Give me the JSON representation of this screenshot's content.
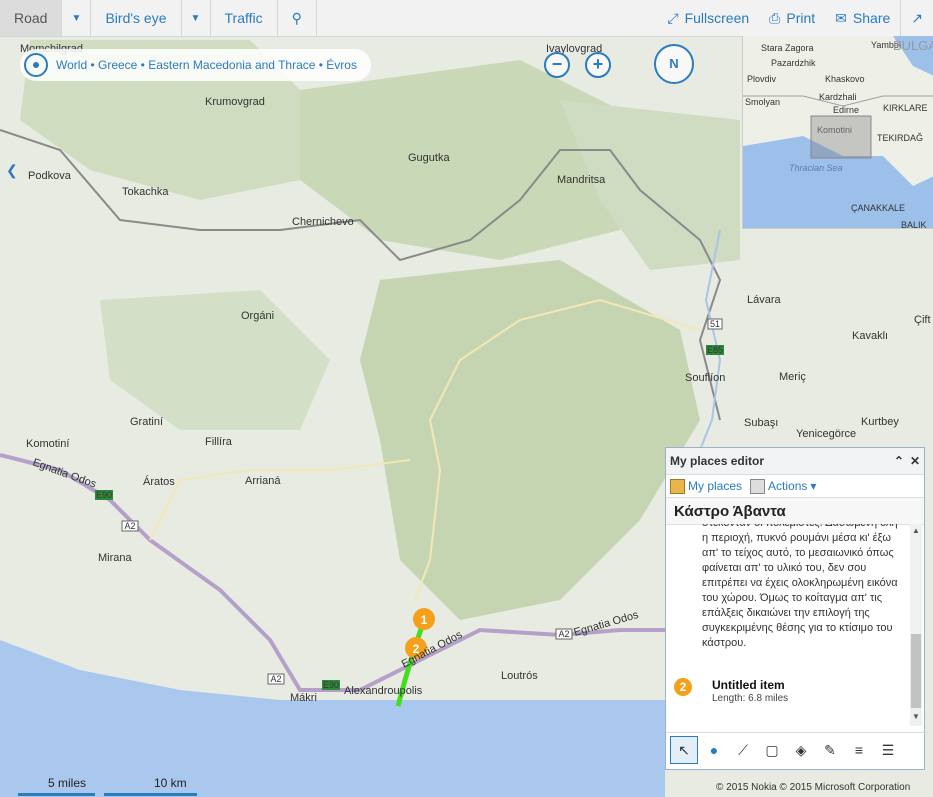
{
  "toolbar": {
    "road": "Road",
    "birds_eye": "Bird's eye",
    "traffic": "Traffic",
    "fullscreen": "Fullscreen",
    "print": "Print",
    "share": "Share"
  },
  "breadcrumb": "World • Greece • Eastern Macedonia and Thrace • Évros",
  "compass": "N",
  "places": {
    "momchilgrad": "Momchilgrad",
    "ivaylovgrad": "Ivaylovgrad",
    "krumovgrad": "Krumovgrad",
    "gugutka": "Gugutka",
    "podkova": "Podkova",
    "tokachka": "Tokachka",
    "mandritsa": "Mandritsa",
    "chernichevo": "Chernichevo",
    "lavara": "Lávara",
    "organi": "Orgáni",
    "kavakli": "Kavaklı",
    "souflion": "Souflíon",
    "meric": "Meriç",
    "gratini": "Gratiní",
    "subasi": "Subaşı",
    "kurtbey": "Kurtbey",
    "yenicegorce": "Yenicegörce",
    "komotini": "Komotiní",
    "fillira": "Fillíra",
    "egnatia_west": "Egnatia Odos",
    "aratos": "Áratos",
    "arriana": "Arrianá",
    "mirana": "Mirana",
    "loutros": "Loutrós",
    "alexandroupolis": "Alexandroupolis",
    "makri": "Mákri",
    "egnatia_east": "Egnatia Odos",
    "egnatia_south": "Egnatia Odos",
    "ciftl": "Çift"
  },
  "road_shields": [
    "E90",
    "A2",
    "A2",
    "A2",
    "E90",
    "51",
    "E85"
  ],
  "route_pins": [
    "1",
    "2"
  ],
  "minimap": {
    "stara_zagora": "Stara Zagora",
    "yambol": "Yambol",
    "bulgaria": "BULGAR",
    "pazardzhik": "Pazardzhik",
    "plovdiv": "Plovdiv",
    "khaskovo": "Khaskovo",
    "smolyan": "Smolyan",
    "kardzhali": "Kardzhali",
    "edirne": "Edirne",
    "kirklareli": "KIRKLARE",
    "komotini": "Komotini",
    "tekirdag": "TEKIRDAĞ",
    "thracian_sea": "Thracian Sea",
    "canakkale": "ÇANAKKALE",
    "balik": "BALIK"
  },
  "panel": {
    "title": "My places editor",
    "tab_my_places": "My places",
    "tab_actions": "Actions",
    "place_name": "Κάστρο Άβαντα",
    "description": "στεκόνταν οι πολεμιστές. Δασωμένη όλη η περιοχή, πυκνό ρουμάνι μέσα κι' έξω απ' το τείχος αυτό, το μεσαιωνικό όπως φαίνεται απ' το υλικό του, δεν σου επιτρέπει να έχεις ολοκληρωμένη εικόνα του χώρου. Όμως το κοίταγμα απ' τις επάλξεις δικαιώνει την επιλογή της συγκεκριμένης θέσης για το κτίσιμο του κάστρου.",
    "item_pin": "2",
    "item_title": "Untitled item",
    "item_length": "Length: 6.8 miles"
  },
  "scale": {
    "miles": "5 miles",
    "km": "10 km"
  },
  "copyright": "© 2015 Nokia    © 2015 Microsoft Corporation",
  "colors": {
    "accent": "#2a7bc0",
    "water": "#aac8ee",
    "route": "#44dd22",
    "pin": "#f5a01b"
  }
}
